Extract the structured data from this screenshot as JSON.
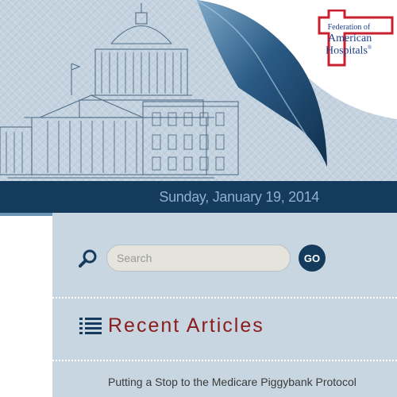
{
  "header": {
    "logo": {
      "line1": "Federation of",
      "line2": "American",
      "line3": "Hospitals"
    },
    "date": "Sunday, January 19, 2014"
  },
  "sidebar": {
    "search": {
      "placeholder": "Search",
      "go_label": "GO"
    },
    "section_title": "Recent Articles",
    "articles": [
      {
        "title": "Putting a Stop to the Medicare Piggybank Protocol"
      }
    ]
  },
  "colors": {
    "navy": "#143a5c",
    "banner_blue": "#c4d3df",
    "panel_blue": "#c7d6e1",
    "title_red": "#8a1c1c",
    "logo_red": "#c8202f",
    "logo_blue": "#1c3f8a"
  }
}
